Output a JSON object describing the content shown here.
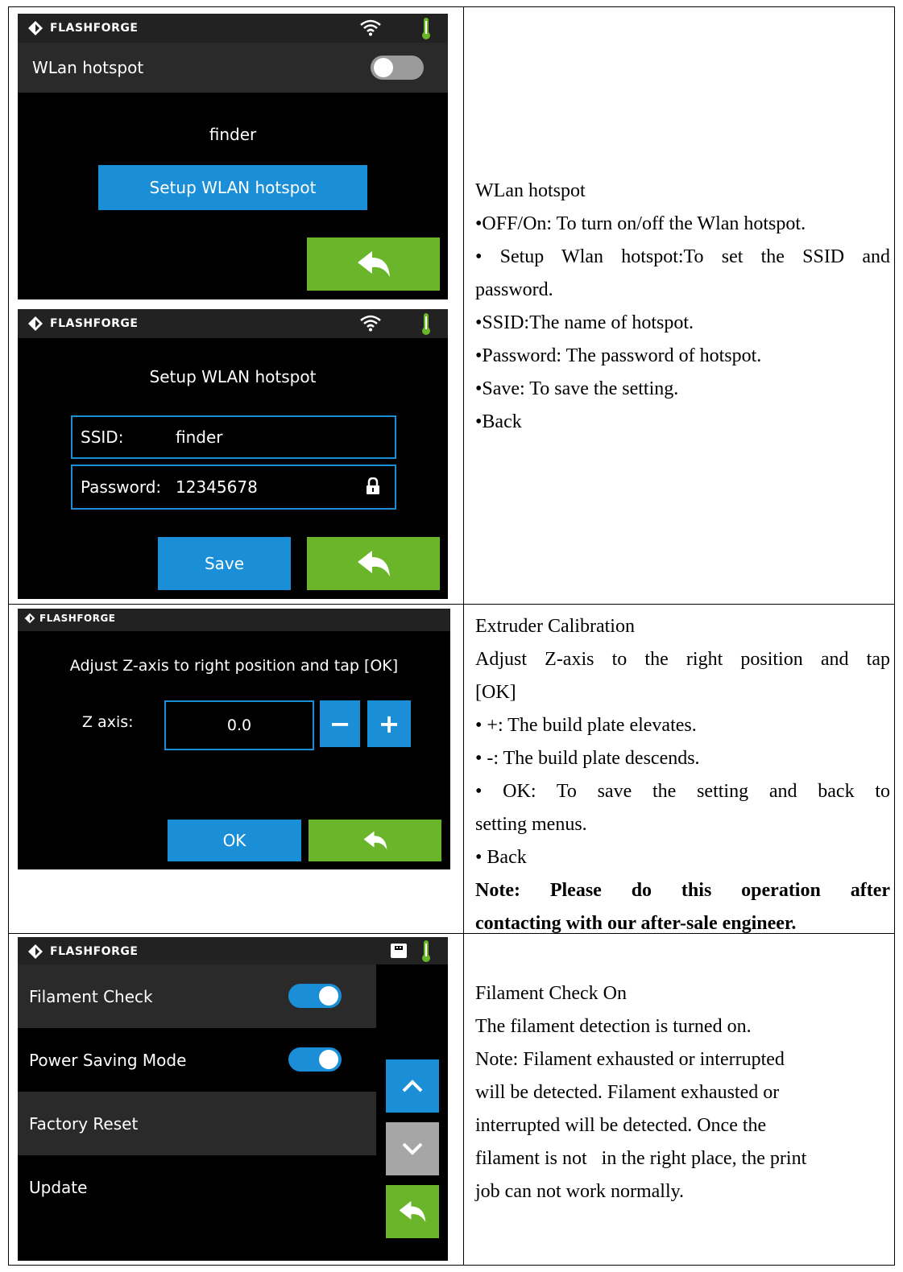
{
  "brand": "FLASHFORGE",
  "screens": {
    "wlan": {
      "title": "WLan hotspot",
      "name": "finder",
      "setup_button": "Setup WLAN hotspot"
    },
    "setup": {
      "title": "Setup WLAN hotspot",
      "ssid_label": "SSID:",
      "ssid_value": "finder",
      "password_label": "Password:",
      "password_value": "12345678",
      "save_button": "Save"
    },
    "calib": {
      "instruction": "Adjust Z-axis to right position and tap [OK]",
      "z_label": "Z axis:",
      "z_value": "0.0",
      "minus": "−",
      "plus": "+",
      "ok_button": "OK"
    },
    "filament": {
      "rows": [
        {
          "label": "Filament Check",
          "toggle": "on"
        },
        {
          "label": "Power Saving Mode",
          "toggle": "on"
        },
        {
          "label": "Factory Reset"
        },
        {
          "label": "Update"
        }
      ]
    }
  },
  "text": {
    "wlan": {
      "l1": "WLan hotspot",
      "l2": "•OFF/On: To turn on/off the Wlan hotspot.",
      "l3": "• Setup Wlan hotspot:To set the SSID and",
      "l4": "password.",
      "l5": "•SSID:The name of hotspot.",
      "l6": "•Password: The password of hotspot.",
      "l7": "•Save: To save the setting.",
      "l8": "•Back"
    },
    "calib": {
      "l1": "Extruder Calibration",
      "l2": "Adjust Z-axis to the right position and tap",
      "l3": "[OK]",
      "l4": "• +: The build plate elevates.",
      "l5": "• -: The build plate descends.",
      "l6": "• OK: To save the setting and back to",
      "l7": "setting menus.",
      "l8": "• Back",
      "l9": "Note: Please do this operation after",
      "l10": "contacting with our after-sale engineer."
    },
    "filament": {
      "l1": "Filament Check On",
      "l2": "The filament detection is turned on.",
      "l3": "Note: Filament exhausted or interrupted",
      "l4": "will be detected. Filament exhausted or",
      "l5": "interrupted will be detected. Once the",
      "l6": "filament is not   in the right place, the print",
      "l7": "job can not work normally."
    }
  },
  "colors": {
    "blue": "#1a8fd8",
    "green": "#6bb52a",
    "grey": "#a6a6a6",
    "bar": "#222222",
    "row": "#2a2a2a"
  },
  "icons": [
    "flashforge-logo-icon",
    "wifi-icon",
    "thermometer-icon",
    "lock-icon",
    "back-arrow-icon",
    "chevron-up-icon",
    "chevron-down-icon",
    "usb-icon"
  ]
}
